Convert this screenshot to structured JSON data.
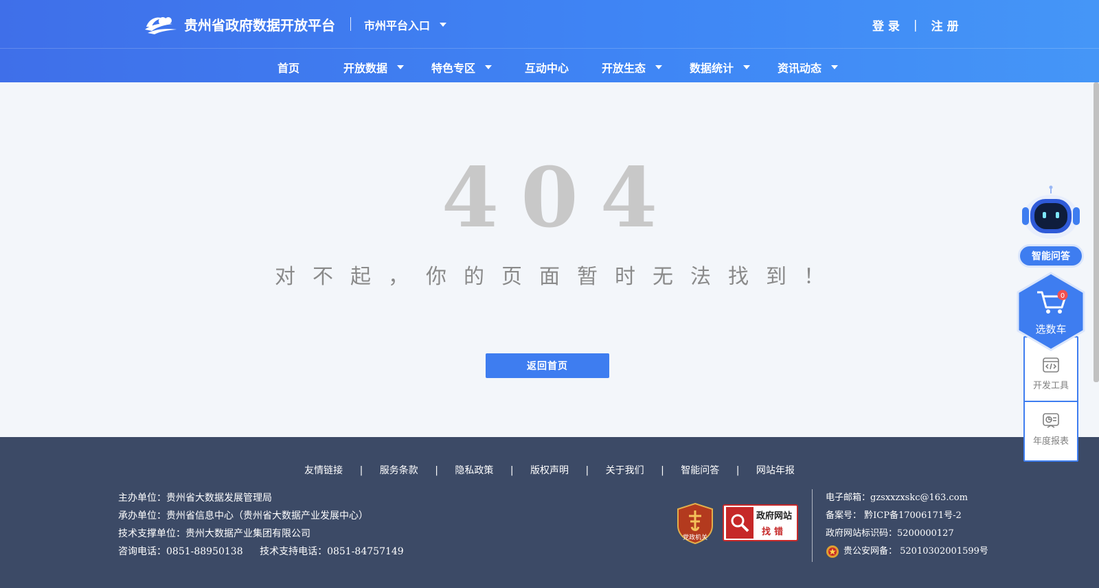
{
  "header": {
    "site_title": "贵州省政府数据开放平台",
    "city_entry": "市州平台入口",
    "login": "登 录",
    "auth_sep": "|",
    "register": "注 册"
  },
  "nav": {
    "items": [
      {
        "label": "首页",
        "has_dropdown": false
      },
      {
        "label": "开放数据",
        "has_dropdown": true
      },
      {
        "label": "特色专区",
        "has_dropdown": true
      },
      {
        "label": "互动中心",
        "has_dropdown": false
      },
      {
        "label": "开放生态",
        "has_dropdown": true
      },
      {
        "label": "数据统计",
        "has_dropdown": true
      },
      {
        "label": "资讯动态",
        "has_dropdown": true
      }
    ]
  },
  "main": {
    "code": "404",
    "message": "对不起，你的页面暂时无法找到！",
    "home_button": "返回首页"
  },
  "footer": {
    "links": [
      "友情链接",
      "服务条款",
      "隐私政策",
      "版权声明",
      "关于我们",
      "智能问答",
      "网站年报"
    ],
    "link_sep": "|",
    "organizer": "主办单位：贵州省大数据发展管理局",
    "undertaker": "承办单位：贵州省信息中心（贵州省大数据产业发展中心）",
    "tech_support": "技术支撑单位：贵州大数据产业集团有限公司",
    "consult_phone": "咨询电话：0851-88950138",
    "support_phone": "技术支持电话：0851-84757149",
    "party_badge_text": "党政机关",
    "gov_badge_line1": "政府网站",
    "gov_badge_line2": "找错",
    "email": "电子邮箱：gzsxxzxskc@163.com",
    "icp": "备案号： 黔ICP备17006171号-2",
    "gov_site_id": "政府网站标识码：5200000127",
    "police_record": "贵公安网备： 52010302001599号"
  },
  "floating": {
    "qa_label": "智能问答",
    "cart_label": "选数车",
    "cart_count": "0",
    "dev_tools_label": "开发工具",
    "annual_report_label": "年度报表"
  },
  "colors": {
    "header_blue": "#3f7ef0",
    "footer_bg": "#3c4a66",
    "page_bg": "#f3f6fa",
    "accent": "#3e7df0",
    "code_gray": "#c8c8c8",
    "badge_red": "#c62828"
  }
}
